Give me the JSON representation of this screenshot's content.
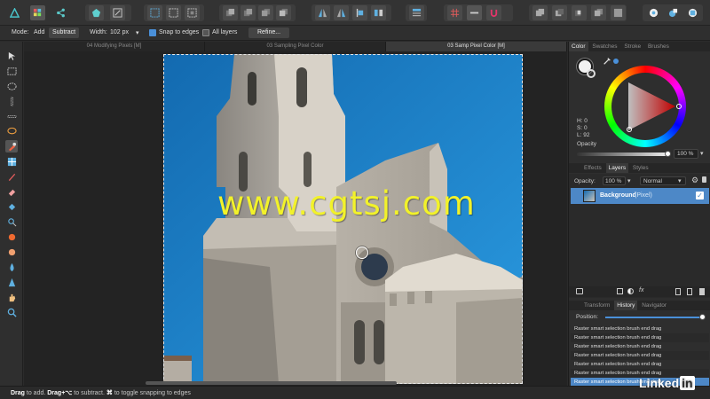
{
  "context_bar": {
    "mode_label": "Mode:",
    "add_label": "Add",
    "subtract_label": "Subtract",
    "width_label": "Width:",
    "width_value": "102 px",
    "snap_label": "Snap to edges",
    "snap_checked": true,
    "all_layers_label": "All layers",
    "all_layers_checked": false,
    "refine_label": "Refine..."
  },
  "doc_tabs": [
    {
      "label": "04 Modifying Pixels [M]",
      "active": false
    },
    {
      "label": "03 Sampling Pixel Color",
      "active": false
    },
    {
      "label": "03 Samp Pixel Color [M]",
      "active": true
    }
  ],
  "canvas": {
    "watermark": "www.cgtsj.com"
  },
  "color_panel": {
    "tabs": [
      "Color",
      "Swatches",
      "Stroke",
      "Brushes"
    ],
    "active_tab": "Color",
    "h_label": "H: 0",
    "s_label": "S: 0",
    "l_label": "L: 92",
    "opacity_label": "Opacity",
    "opacity_value": "100 %",
    "opacity_fraction": 1.0
  },
  "layers_panel": {
    "tabs": [
      "Effects",
      "Layers",
      "Styles"
    ],
    "active_tab": "Layers",
    "opacity_label": "Opacity:",
    "opacity_value": "100 %",
    "blend_mode": "Normal",
    "layers": [
      {
        "name": "Background",
        "type": "(Pixel)",
        "visible": true,
        "selected": true
      }
    ]
  },
  "history_panel": {
    "tabs": [
      "Transform",
      "History",
      "Navigator"
    ],
    "active_tab": "History",
    "position_label": "Position:",
    "position_fraction": 1.0,
    "items": [
      {
        "label": "Raster smart selection brush end drag",
        "selected": false
      },
      {
        "label": "Raster smart selection brush end drag",
        "selected": false
      },
      {
        "label": "Raster smart selection brush end drag",
        "selected": false
      },
      {
        "label": "Raster smart selection brush end drag",
        "selected": false
      },
      {
        "label": "Raster smart selection brush end drag",
        "selected": false
      },
      {
        "label": "Raster smart selection brush end drag",
        "selected": false
      },
      {
        "label": "Raster smart selection brush end drag",
        "selected": true
      }
    ]
  },
  "status_bar": {
    "drag1": "Drag",
    "text1": " to add. ",
    "drag2": "Drag+⌥",
    "text2": " to subtract. ",
    "key3": "⌘",
    "text3": " to toggle snapping to edges"
  },
  "watermark_brand": {
    "text": "Linked",
    "in": "in"
  },
  "colors": {
    "accent": "#4a90d9",
    "selected_row": "#4d88c7",
    "watermark": "#f2f22a",
    "sky": "#1a7fc4"
  },
  "icons": {
    "app_logo": "affinity-logo-icon",
    "persona_pixel": "pixel-persona-icon",
    "persona_share": "export-persona-icon"
  }
}
